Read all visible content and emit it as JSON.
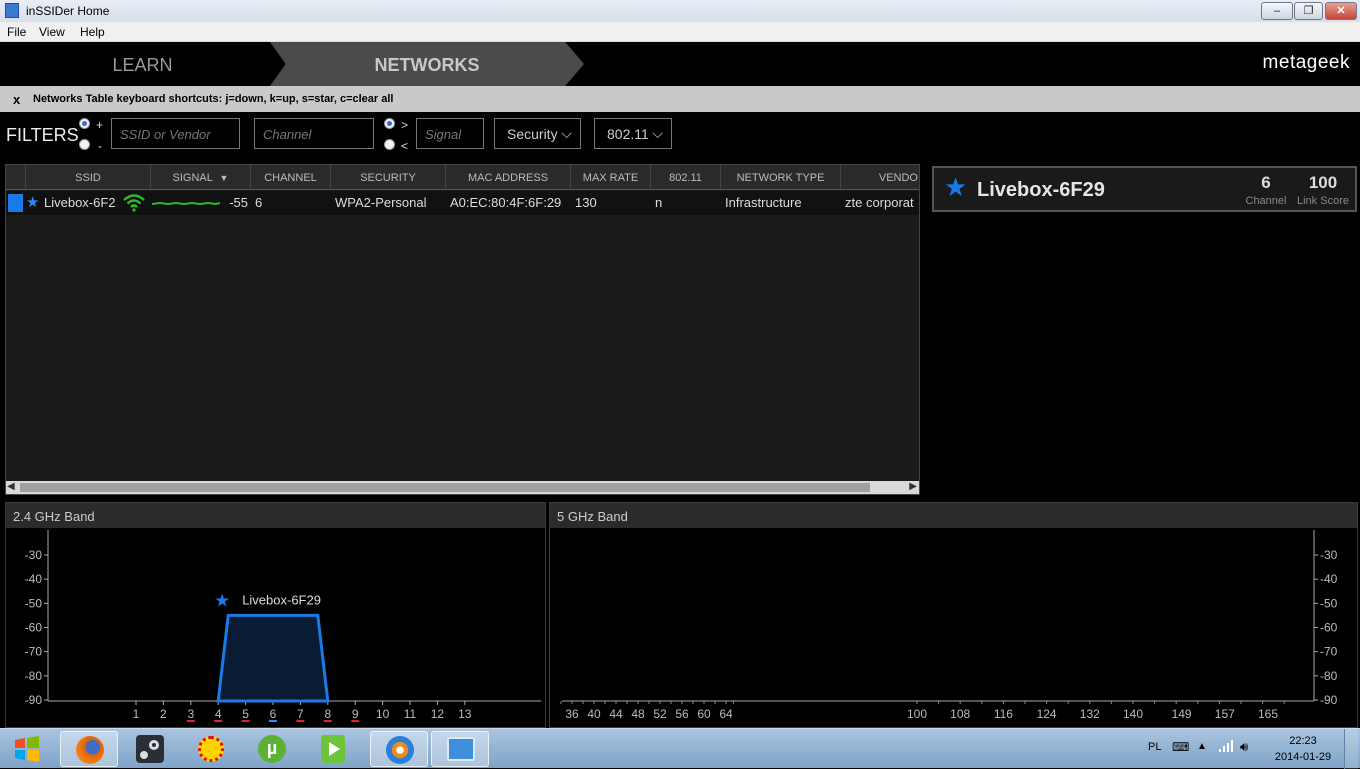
{
  "window": {
    "title": "inSSIDer Home",
    "buttons": [
      "–",
      "❐",
      "✕"
    ]
  },
  "menu": {
    "items": [
      "File",
      "View",
      "Help"
    ]
  },
  "nav": {
    "tabs": [
      "LEARN",
      "NETWORKS"
    ],
    "active_tab": "NETWORKS",
    "logo": "metageek"
  },
  "shortcuts": {
    "close": "x",
    "text": "Networks Table keyboard shortcuts: j=down, k=up, s=star, c=clear all"
  },
  "filters": {
    "label": "FILTERS",
    "include_plus": "+",
    "include_minus": "-",
    "ssid_placeholder": "SSID or Vendor",
    "channel_placeholder": "Channel",
    "signal_gt": ">",
    "signal_lt": "<",
    "signal_placeholder": "Signal",
    "security": "Security",
    "standard": "802.11"
  },
  "table": {
    "columns": [
      "SSID",
      "SIGNAL",
      "CHANNEL",
      "SECURITY",
      "MAC ADDRESS",
      "MAX RATE",
      "802.11",
      "NETWORK TYPE",
      "VENDO"
    ],
    "rows": [
      {
        "ssid": "Livebox-6F2",
        "signal": "-55",
        "channel": "6",
        "security": "WPA2-Personal",
        "mac": "A0:EC:80:4F:6F:29",
        "max_rate": "130",
        "standard": "n",
        "network_type": "Infrastructure",
        "vendor": "zte corporat"
      }
    ]
  },
  "detail": {
    "ssid": "Livebox-6F29",
    "channel": "6",
    "channel_label": "Channel",
    "link_score": "100",
    "link_score_label": "Link Score"
  },
  "band24": {
    "title": "2.4 GHz Band",
    "y_ticks": [
      "-30",
      "-40",
      "-50",
      "-60",
      "-70",
      "-80",
      "-90"
    ],
    "x_ticks": [
      "1",
      "2",
      "3",
      "4",
      "5",
      "6",
      "7",
      "8",
      "9",
      "10",
      "11",
      "12",
      "13"
    ],
    "network_label": "Livebox-6F29"
  },
  "band5": {
    "title": "5 GHz Band",
    "y_ticks": [
      "-30",
      "-40",
      "-50",
      "-60",
      "-70",
      "-80",
      "-90"
    ],
    "x_ticks": [
      "36",
      "40",
      "44",
      "48",
      "52",
      "56",
      "60",
      "64",
      "100",
      "108",
      "116",
      "124",
      "132",
      "140",
      "149",
      "157",
      "165"
    ]
  },
  "chart_data": [
    {
      "type": "area",
      "title": "2.4 GHz Band",
      "xlabel": "",
      "ylabel": "",
      "ylim": [
        -90,
        -30
      ],
      "x_ticks": [
        1,
        2,
        3,
        4,
        5,
        6,
        7,
        8,
        9,
        10,
        11,
        12,
        13
      ],
      "series": [
        {
          "name": "Livebox-6F29",
          "channel": 6,
          "span": [
            4,
            8
          ],
          "signal": -55
        }
      ]
    },
    {
      "type": "area",
      "title": "5 GHz Band",
      "xlabel": "",
      "ylabel": "",
      "ylim": [
        -90,
        -30
      ],
      "x_ticks": [
        36,
        40,
        44,
        48,
        52,
        56,
        60,
        64,
        100,
        108,
        116,
        124,
        132,
        140,
        149,
        157,
        165
      ],
      "series": []
    }
  ],
  "taskbar": {
    "apps": [
      "windows-start",
      "firefox",
      "steam",
      "sun-app",
      "utorrent",
      "video-player",
      "inssider",
      "control-panel"
    ],
    "language": "PL",
    "time": "22:23",
    "date": "2014-01-29"
  }
}
